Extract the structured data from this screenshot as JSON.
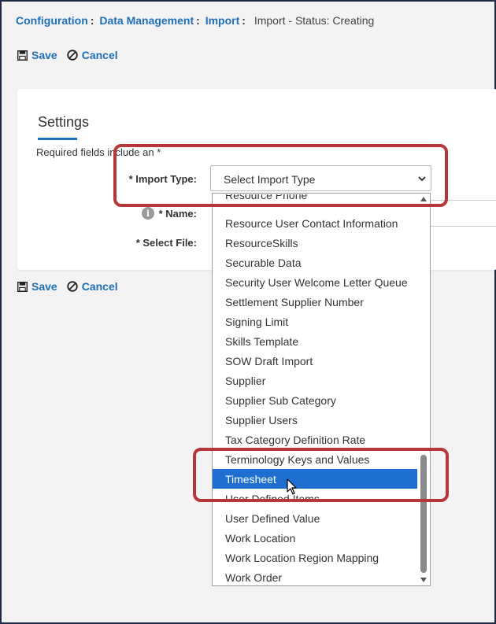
{
  "breadcrumb": {
    "items": [
      "Configuration",
      "Data Management",
      "Import"
    ],
    "separator": ":",
    "status": "Import - Status: Creating"
  },
  "actions": {
    "save_label": "Save",
    "cancel_label": "Cancel"
  },
  "settings": {
    "title": "Settings",
    "required_note": "Required fields include an *",
    "import_type_label": "* Import Type:",
    "name_label": "* Name:",
    "select_file_label": "* Select File:",
    "info_icon_glyph": "i"
  },
  "import_type_select": {
    "selected_value": "Select Import Type"
  },
  "dropdown": {
    "options": [
      "Resource Phone",
      "Resource User Contact Information",
      "ResourceSkills",
      "Securable Data",
      "Security User Welcome Letter Queue",
      "Settlement Supplier Number",
      "Signing Limit",
      "Skills Template",
      "SOW Draft Import",
      "Supplier",
      "Supplier Sub Category",
      "Supplier Users",
      "Tax Category Definition Rate",
      "Terminology Keys and Values",
      "Timesheet",
      "User Defined Items",
      "User Defined Value",
      "Work Location",
      "Work Location Region Mapping",
      "Work Order"
    ],
    "highlighted": "Timesheet"
  },
  "colors": {
    "link": "#1f6fb8",
    "selection": "#1e6fd0",
    "annotation": "#b5373a"
  },
  "icons": {
    "save": "floppy-disk-icon",
    "cancel": "prohibited-circle-icon",
    "info": "info-circle-icon",
    "chevron": "chevron-down-icon",
    "cursor": "mouse-pointer-icon"
  }
}
